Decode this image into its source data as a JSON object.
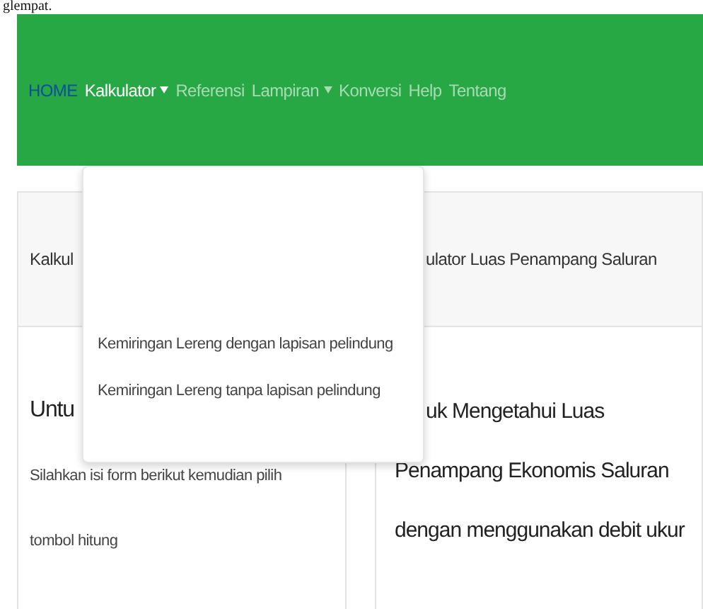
{
  "document_fragment": "glempat.",
  "navbar": {
    "brand": "HOME",
    "items": [
      {
        "label": "Kalkulator",
        "dropdown": true,
        "selected": true
      },
      {
        "label": "Referensi",
        "dropdown": false,
        "selected": false
      },
      {
        "label": "Lampiran",
        "dropdown": true,
        "selected": false
      },
      {
        "label": "Konversi",
        "dropdown": false,
        "selected": false
      },
      {
        "label": "Help",
        "dropdown": false,
        "selected": false
      },
      {
        "label": "Tentang",
        "dropdown": false,
        "selected": false
      }
    ]
  },
  "dropdown_menu": {
    "items": [
      "Kemiringan Lereng dengan lapisan pelindung",
      "Kemiringan Lereng tanpa lapisan pelindung"
    ]
  },
  "left_card": {
    "header": "Kalkul",
    "title": "Untu",
    "description": "Silahkan isi form berikut kemudian pilih tombol hitung"
  },
  "right_card": {
    "header": "ulator Luas Penampang Saluran",
    "title": "uk Mengetahui Luas Penampang Ekonomis Saluran dengan menggunakan debit ukur"
  }
}
